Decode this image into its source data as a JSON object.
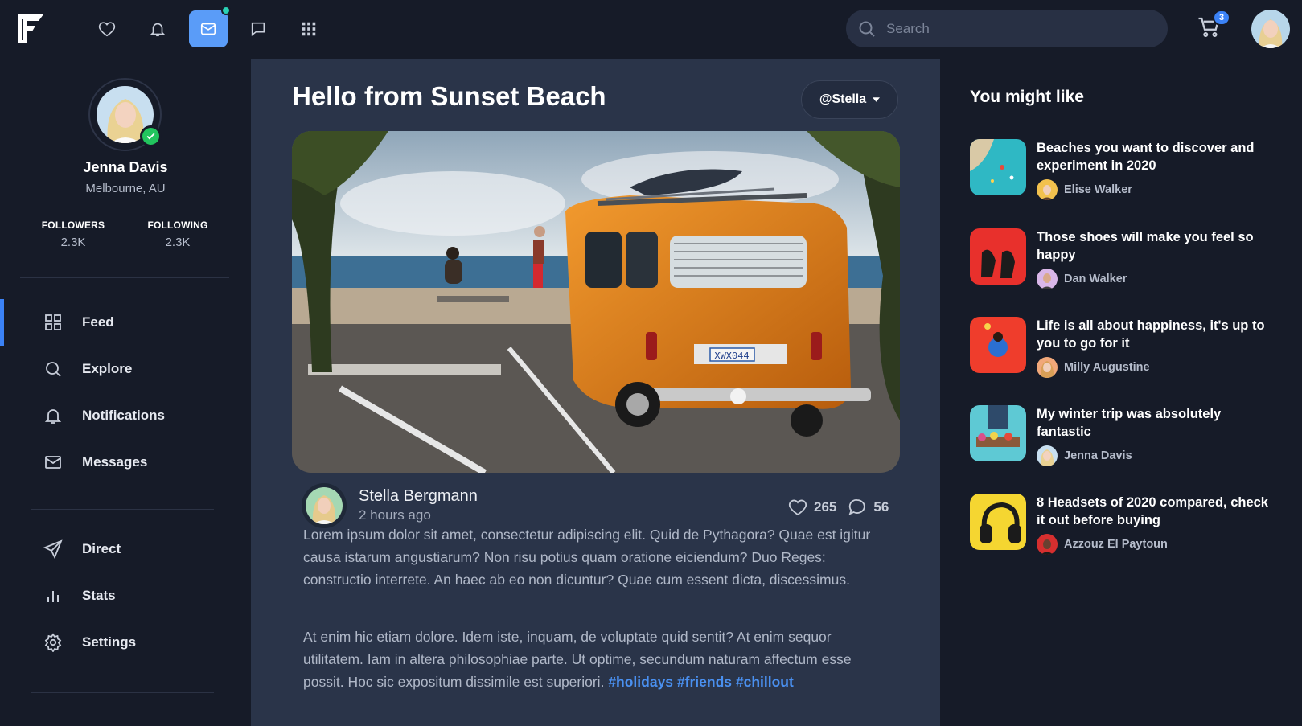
{
  "header": {
    "search_placeholder": "Search",
    "cart_count": "3",
    "nav_icons": [
      "heart-icon",
      "bell-icon",
      "mail-icon",
      "chat-icon",
      "grid-icon"
    ],
    "accent": "#5a9cf8"
  },
  "profile": {
    "name": "Jenna Davis",
    "location": "Melbourne, AU",
    "followers_label": "FOLLOWERS",
    "followers": "2.3K",
    "following_label": "FOLLOWING",
    "following": "2.3K"
  },
  "menu": {
    "feed": "Feed",
    "explore": "Explore",
    "notifications": "Notifications",
    "messages": "Messages",
    "direct": "Direct",
    "stats": "Stats",
    "settings": "Settings"
  },
  "post": {
    "title": "Hello from Sunset Beach",
    "user_select": "@Stella",
    "author": "Stella Bergmann",
    "time": "2 hours ago",
    "likes": "265",
    "comments": "56",
    "para1": "Lorem ipsum dolor sit amet, consectetur adipiscing elit. Quid de Pythagora? Quae est igitur causa istarum angustiarum? Non risu potius quam oratione eiciendum? Duo Reges: constructio interrete. An haec ab eo non dicuntur? Quae cum essent dicta, discessimus.",
    "para2": "At enim hic etiam dolore. Idem iste, inquam, de voluptate quid sentit? At enim sequor utilitatem. Iam in altera philosophiae parte. Ut optime, secundum naturam affectum esse possit. Hoc sic expositum dissimile est superiori.",
    "tags": [
      "#holidays",
      "#friends",
      "#chillout"
    ]
  },
  "suggestions": {
    "title": "You might like",
    "items": [
      {
        "title": "Beaches you want to discover and experiment in 2020",
        "author": "Elise Walker"
      },
      {
        "title": "Those shoes will make you feel so happy",
        "author": "Dan Walker"
      },
      {
        "title": "Life is all about happiness, it's up to you to go for it",
        "author": "Milly Augustine"
      },
      {
        "title": "My winter trip was absolutely fantastic",
        "author": "Jenna Davis"
      },
      {
        "title": "8 Headsets of 2020 compared, check it out before buying",
        "author": "Azzouz El Paytoun"
      }
    ]
  }
}
